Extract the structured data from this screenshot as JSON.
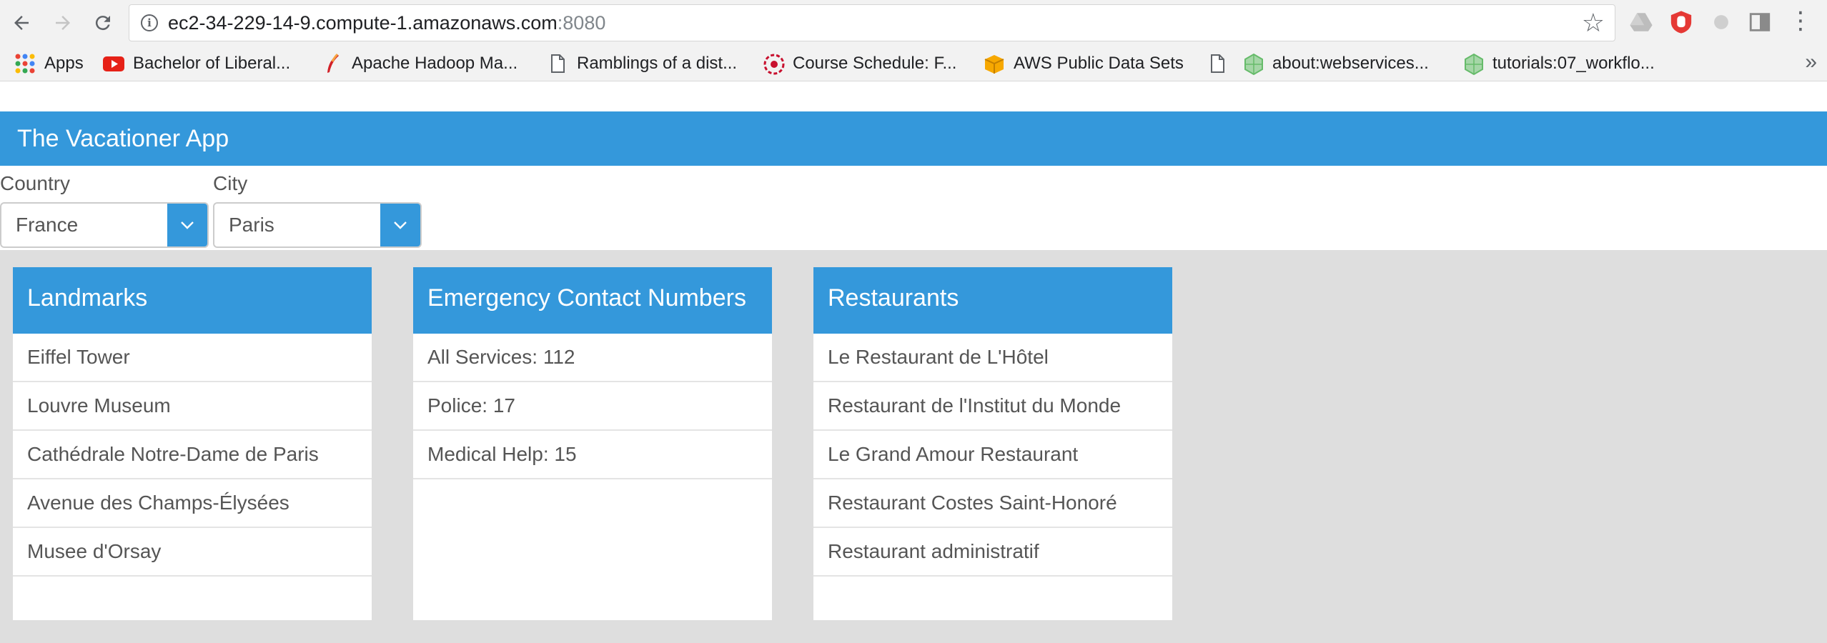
{
  "browser": {
    "url_host": "ec2-34-229-14-9.compute-1.amazonaws.com",
    "url_port": ":8080",
    "nav_icons": {
      "back": "back-arrow-icon",
      "forward": "forward-arrow-icon",
      "reload": "reload-icon",
      "info": "info-icon",
      "star": "star-icon",
      "menu": "kebab-menu-icon"
    },
    "extensions": [
      "google-drive-icon",
      "ublock-icon",
      "extension-icon",
      "pane-icon"
    ],
    "bookmarks": [
      {
        "label": "Apps",
        "icon": "apps-grid-icon"
      },
      {
        "label": "Bachelor of Liberal...",
        "icon": "youtube-icon"
      },
      {
        "label": "Apache Hadoop Ma...",
        "icon": "apache-feather-icon"
      },
      {
        "label": "Ramblings of a dist...",
        "icon": "page-icon"
      },
      {
        "label": "Course Schedule: F...",
        "icon": "course-schedule-icon"
      },
      {
        "label": "AWS Public Data Sets",
        "icon": "aws-icon"
      },
      {
        "label": "",
        "icon": "page-icon"
      },
      {
        "label": "about:webservices...",
        "icon": "webservices-icon"
      },
      {
        "label": "tutorials:07_workflo...",
        "icon": "webservices-icon"
      }
    ],
    "more_bookmarks": "»"
  },
  "app": {
    "title": "The Vacationer App",
    "country_label": "Country",
    "country_value": "France",
    "city_label": "City",
    "city_value": "Paris"
  },
  "cards": [
    {
      "title": "Landmarks",
      "items": [
        "Eiffel Tower",
        "Louvre Museum",
        "Cathédrale Notre-Dame de Paris",
        "Avenue des Champs-Élysées",
        "Musee d'Orsay"
      ]
    },
    {
      "title": "Emergency Contact Numbers",
      "items": [
        "All Services: 112",
        "Police: 17",
        "Medical Help: 15"
      ]
    },
    {
      "title": "Restaurants",
      "items": [
        "Le Restaurant de L'Hôtel",
        "Restaurant de l'Institut du Monde",
        "Le Grand Amour Restaurant",
        "Restaurant Costes Saint-Honoré",
        "Restaurant administratif"
      ]
    }
  ],
  "colors": {
    "primary": "#3498db",
    "content_bg": "#dedede",
    "text": "#555555"
  }
}
